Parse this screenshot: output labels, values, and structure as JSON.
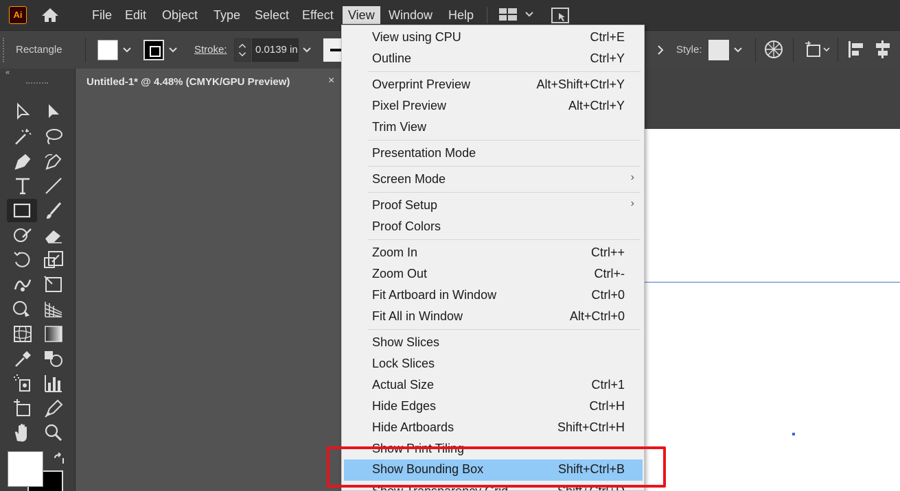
{
  "app": {
    "logo": "Ai"
  },
  "menubar": {
    "items": [
      "File",
      "Edit",
      "Object",
      "Type",
      "Select",
      "Effect",
      "View",
      "Window",
      "Help"
    ],
    "active": "View"
  },
  "controlbar": {
    "tool_name": "Rectangle",
    "stroke_label": "Stroke:",
    "stroke_value": "0.0139 in",
    "style_label": "Style:"
  },
  "document": {
    "tab_title": "Untitled-1* @ 4.48% (CMYK/GPU Preview)",
    "close_glyph": "×"
  },
  "view_menu": {
    "items": [
      {
        "label": "View using CPU",
        "shortcut": "Ctrl+E"
      },
      {
        "label": "Outline",
        "shortcut": "Ctrl+Y"
      },
      {
        "label": "Overprint Preview",
        "shortcut": "Alt+Shift+Ctrl+Y"
      },
      {
        "label": "Pixel Preview",
        "shortcut": "Alt+Ctrl+Y"
      },
      {
        "label": "Trim View",
        "shortcut": ""
      },
      {
        "label": "Presentation Mode",
        "shortcut": ""
      },
      {
        "label": "Screen Mode",
        "shortcut": "",
        "submenu": true
      },
      {
        "label": "Proof Setup",
        "shortcut": "",
        "submenu": true
      },
      {
        "label": "Proof Colors",
        "shortcut": ""
      },
      {
        "label": "Zoom In",
        "shortcut": "Ctrl++"
      },
      {
        "label": "Zoom Out",
        "shortcut": "Ctrl+-"
      },
      {
        "label": "Fit Artboard in Window",
        "shortcut": "Ctrl+0"
      },
      {
        "label": "Fit All in Window",
        "shortcut": "Alt+Ctrl+0"
      },
      {
        "label": "Show Slices",
        "shortcut": ""
      },
      {
        "label": "Lock Slices",
        "shortcut": ""
      },
      {
        "label": "Actual Size",
        "shortcut": "Ctrl+1"
      },
      {
        "label": "Hide Edges",
        "shortcut": "Ctrl+H"
      },
      {
        "label": "Hide Artboards",
        "shortcut": "Shift+Ctrl+H"
      },
      {
        "label": "Show Print Tiling",
        "shortcut": ""
      },
      {
        "label": "Show Bounding Box",
        "shortcut": "Shift+Ctrl+B",
        "highlighted": true
      },
      {
        "label": "Show Transparency Grid",
        "shortcut": "Shift+Ctrl+D"
      }
    ],
    "submenu_glyph": "›"
  },
  "colors": {
    "menubar": "#323232",
    "highlight": "#91c9f7",
    "annotation_box": "#e8141c"
  }
}
